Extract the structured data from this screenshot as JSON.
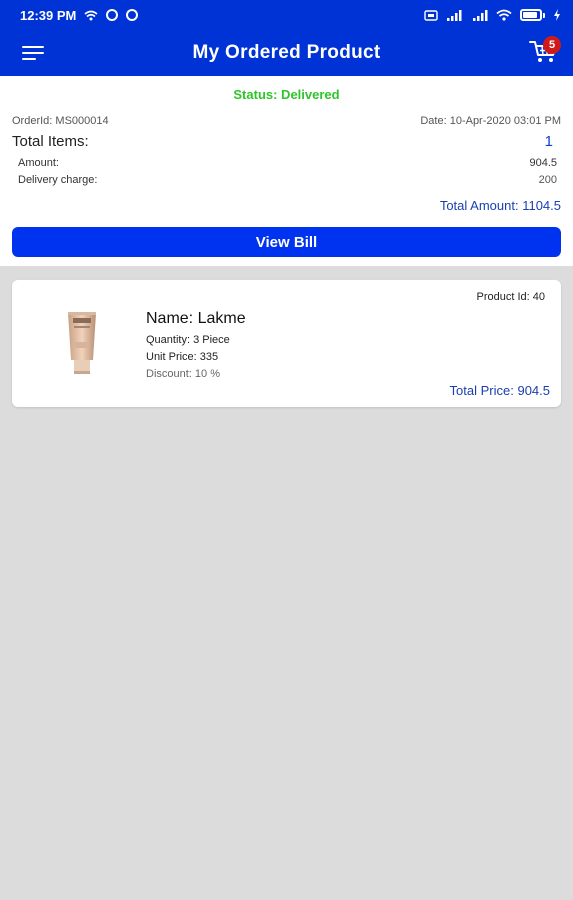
{
  "status_bar": {
    "time": "12:39 PM",
    "left_icons": [
      "wifi-icon",
      "circle-icon",
      "circle-icon"
    ],
    "right_icons": [
      "sim-icon",
      "signal-icon",
      "signal-icon",
      "wifi-icon",
      "battery-icon",
      "charging-icon"
    ],
    "battery_level_percent": 90
  },
  "appbar": {
    "title": "My Ordered Product",
    "menu_icon": "menu-icon",
    "cart_icon": "cart-icon",
    "cart_badge": "5"
  },
  "order": {
    "status": "Status: Delivered",
    "order_id": "OrderId: MS000014",
    "date": "Date: 10-Apr-2020 03:01 PM",
    "total_items_label": "Total Items:",
    "total_items_value": "1",
    "amount_label": "Amount:",
    "amount_value": "904.5",
    "delivery_label": "Delivery charge:",
    "delivery_value": "200",
    "total_amount": "Total Amount: 1104.5",
    "view_bill_label": "View Bill"
  },
  "products": [
    {
      "image_icon": "product-tube-image",
      "product_id": "Product Id: 40",
      "name": "Name: Lakme",
      "quantity": "Quantity: 3 Piece",
      "unit_price": "Unit Price: 335",
      "discount": "Discount: 10 %",
      "total_price": "Total Price: 904.5"
    }
  ],
  "colors": {
    "primary": "#0033d6",
    "button": "#0033f0",
    "status_green": "#2ec52a",
    "link_blue": "#1a3fb0",
    "badge_red": "#d01a1a",
    "background": "#dcdcdc"
  }
}
